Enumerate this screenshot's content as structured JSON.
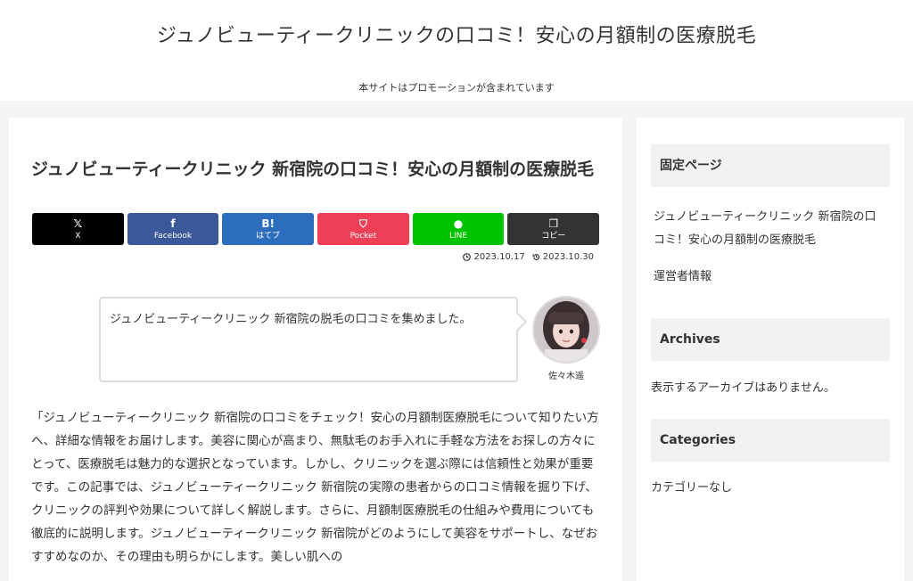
{
  "header": {
    "site_title": "ジュノビューティークリニックの口コミ！安心の月額制の医療脱毛",
    "tagline": "本サイトはプロモーションが含まれています"
  },
  "article": {
    "title": "ジュノビューティークリニック 新宿院の口コミ！安心の月額制の医療脱毛",
    "share_buttons": [
      {
        "icon": "x-icon",
        "glyph": "𝕏",
        "label": "X",
        "color": "#000000"
      },
      {
        "icon": "facebook-icon",
        "glyph": "f",
        "label": "Facebook",
        "color": "#3b5998"
      },
      {
        "icon": "hatena-icon",
        "glyph": "B!",
        "label": "はてブ",
        "color": "#2c6ebd"
      },
      {
        "icon": "pocket-icon",
        "glyph": "⛉",
        "label": "Pocket",
        "color": "#ef3f56"
      },
      {
        "icon": "line-icon",
        "glyph": "●",
        "label": "LINE",
        "color": "#00c300"
      },
      {
        "icon": "copy-icon",
        "glyph": "❐",
        "label": "コピー",
        "color": "#333333"
      }
    ],
    "posted_date": "2023.10.17",
    "updated_date": "2023.10.30",
    "balloon_text": "ジュノビューティークリニック 新宿院の脱毛の口コミを集めました。",
    "author_name": "佐々木遥",
    "body": "「ジュノビューティークリニック 新宿院の口コミをチェック！安心の月額制医療脱毛について知りたい方へ、詳細な情報をお届けします。美容に関心が高まり、無駄毛のお手入れに手軽な方法をお探しの方々にとって、医療脱毛は魅力的な選択となっています。しかし、クリニックを選ぶ際には信頼性と効果が重要です。この記事では、ジュノビューティークリニック 新宿院の実際の患者からの口コミ情報を掘り下げ、クリニックの評判や効果について詳しく解説します。さらに、月額制医療脱毛の仕組みや費用についても徹底的に説明します。ジュノビューティークリニック 新宿院がどのようにして美容をサポートし、なぜおすすめなのか、その理由も明らかにします。美しい肌への"
  },
  "sidebar": {
    "fixed_title": "固定ページ",
    "fixed_links": [
      "ジュノビューティークリニック 新宿院の口コミ！安心の月額制の医療脱毛",
      "運営者情報"
    ],
    "archives_title": "Archives",
    "archives_empty": "表示するアーカイブはありません。",
    "categories_title": "Categories",
    "categories_empty": "カテゴリーなし"
  }
}
